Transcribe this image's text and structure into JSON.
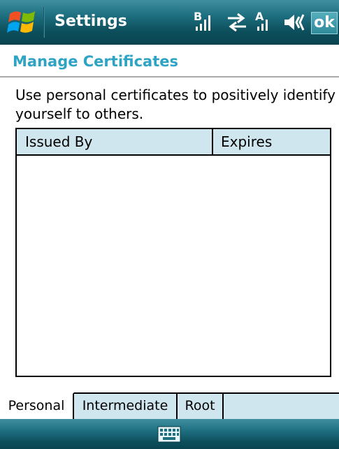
{
  "titlebar": {
    "title": "Settings",
    "ok_label": "ok",
    "icons": [
      "windows-start-icon",
      "bluetooth-signal-icon",
      "sync-arrows-icon",
      "signal-bars-icon",
      "speaker-icon"
    ]
  },
  "page": {
    "heading": "Manage Certificates",
    "description": "Use personal certificates to positively identify yourself to others."
  },
  "certificate_list": {
    "columns": [
      "Issued By",
      "Expires"
    ],
    "rows": []
  },
  "tabs": [
    {
      "label": "Personal",
      "active": true
    },
    {
      "label": "Intermediate",
      "active": false
    },
    {
      "label": "Root",
      "active": false
    }
  ],
  "bottombar": {
    "icons": [
      "keyboard-icon"
    ]
  },
  "colors": {
    "titlebar": "#1e6f80",
    "heading": "#2ea4c4",
    "header_fill": "#cfe6ef"
  }
}
